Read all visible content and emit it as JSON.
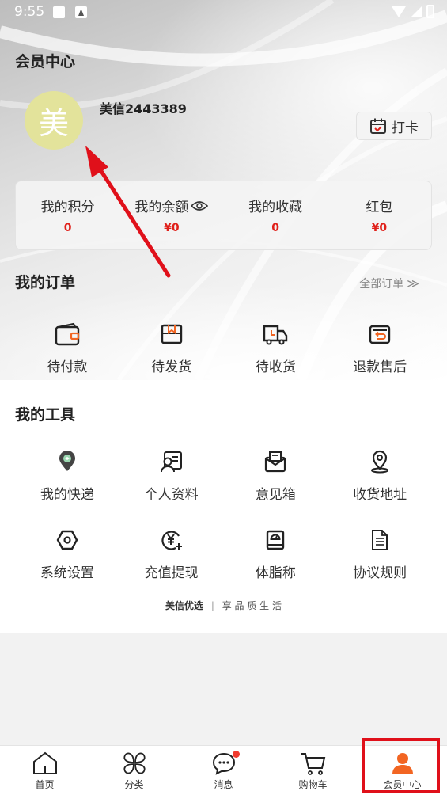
{
  "status_bar": {
    "time": "9:55"
  },
  "header": {
    "title": "会员中心"
  },
  "profile": {
    "avatar_char": "美",
    "username": "美信2443389",
    "checkin_label": "打卡"
  },
  "stats": [
    {
      "label": "我的积分",
      "value": "0"
    },
    {
      "label": "我的余额",
      "value": "¥0",
      "icon": "eye-icon"
    },
    {
      "label": "我的收藏",
      "value": "0"
    },
    {
      "label": "红包",
      "value": "¥0"
    }
  ],
  "orders": {
    "title": "我的订单",
    "all_link": "全部订单",
    "items": [
      {
        "label": "待付款",
        "icon": "wallet-icon"
      },
      {
        "label": "待发货",
        "icon": "package-icon"
      },
      {
        "label": "待收货",
        "icon": "truck-icon"
      },
      {
        "label": "退款售后",
        "icon": "refund-icon"
      }
    ]
  },
  "tools": {
    "title": "我的工具",
    "items": [
      {
        "label": "我的快递",
        "icon": "delivery-pin-icon"
      },
      {
        "label": "个人资料",
        "icon": "profile-card-icon"
      },
      {
        "label": "意见箱",
        "icon": "mailbox-icon"
      },
      {
        "label": "收货地址",
        "icon": "location-icon"
      },
      {
        "label": "系统设置",
        "icon": "settings-hex-icon"
      },
      {
        "label": "充值提现",
        "icon": "yuan-plus-icon"
      },
      {
        "label": "体脂称",
        "icon": "scale-icon"
      },
      {
        "label": "协议规则",
        "icon": "document-icon"
      }
    ]
  },
  "slogan": {
    "brand": "美信优选",
    "separator": "|",
    "tagline": "享 品 质 生 活"
  },
  "tabbar": [
    {
      "label": "首页",
      "icon": "home-icon"
    },
    {
      "label": "分类",
      "icon": "category-icon"
    },
    {
      "label": "消息",
      "icon": "message-icon",
      "badge": true
    },
    {
      "label": "购物车",
      "icon": "cart-icon"
    },
    {
      "label": "会员中心",
      "icon": "person-icon",
      "active": true
    }
  ],
  "colors": {
    "accent_red": "#e0201a",
    "active_tab": "#f26522",
    "highlight_box": "#e0101a",
    "arrow": "#e0101a"
  }
}
